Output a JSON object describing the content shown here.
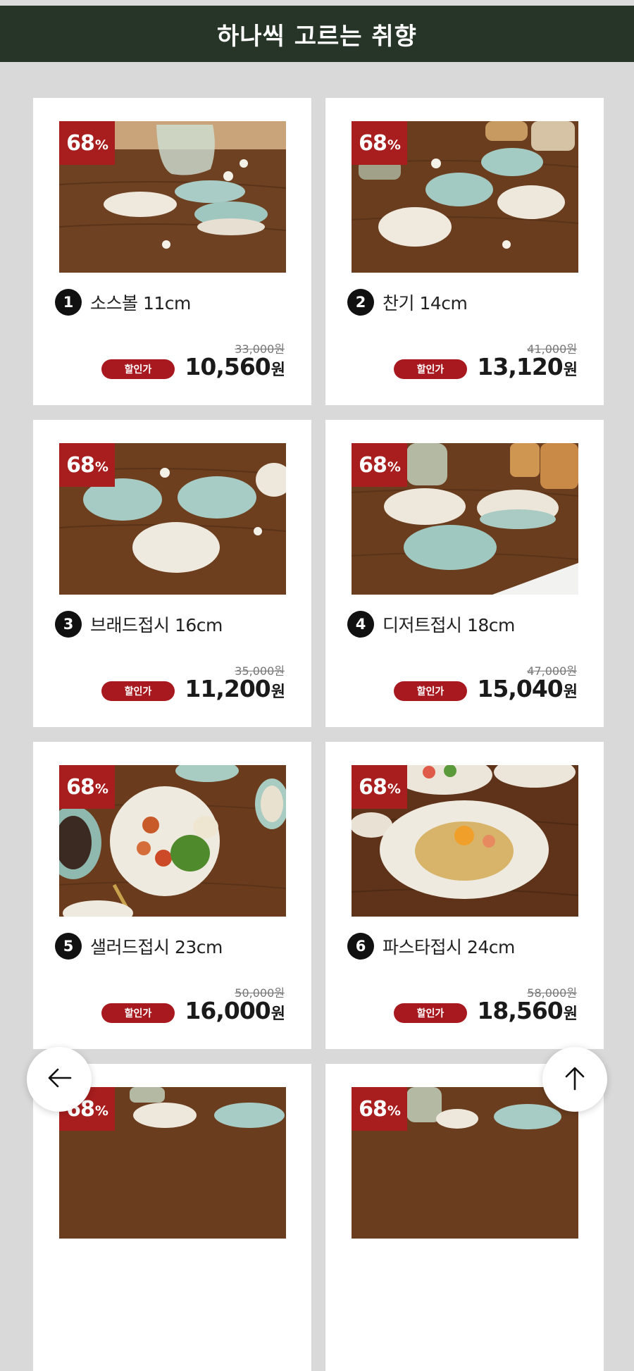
{
  "header": {
    "title": "하나씩 고르는 취향"
  },
  "products": [
    {
      "number": "1",
      "name": "소스볼 11cm",
      "discount": "68",
      "percent_sign": "%",
      "original_price": "33,000원",
      "sale_label": "할인가",
      "price": "10,560",
      "currency": "원"
    },
    {
      "number": "2",
      "name": "찬기 14cm",
      "discount": "68",
      "percent_sign": "%",
      "original_price": "41,000원",
      "sale_label": "할인가",
      "price": "13,120",
      "currency": "원"
    },
    {
      "number": "3",
      "name": "브래드접시 16cm",
      "discount": "68",
      "percent_sign": "%",
      "original_price": "35,000원",
      "sale_label": "할인가",
      "price": "11,200",
      "currency": "원"
    },
    {
      "number": "4",
      "name": "디저트접시 18cm",
      "discount": "68",
      "percent_sign": "%",
      "original_price": "47,000원",
      "sale_label": "할인가",
      "price": "15,040",
      "currency": "원"
    },
    {
      "number": "5",
      "name": "샐러드접시 23cm",
      "discount": "68",
      "percent_sign": "%",
      "original_price": "50,000원",
      "sale_label": "할인가",
      "price": "16,000",
      "currency": "원"
    },
    {
      "number": "6",
      "name": "파스타접시 24cm",
      "discount": "68",
      "percent_sign": "%",
      "original_price": "58,000원",
      "sale_label": "할인가",
      "price": "18,560",
      "currency": "원"
    },
    {
      "discount": "68",
      "percent_sign": "%"
    },
    {
      "discount": "68",
      "percent_sign": "%"
    }
  ],
  "nav": {
    "back_icon": "arrow-left-icon",
    "top_icon": "arrow-up-icon"
  },
  "colors": {
    "header_bg": "#263527",
    "badge": "#a81e1e",
    "sale_tag": "#a8191f",
    "page_bg": "#d9d9d9"
  }
}
